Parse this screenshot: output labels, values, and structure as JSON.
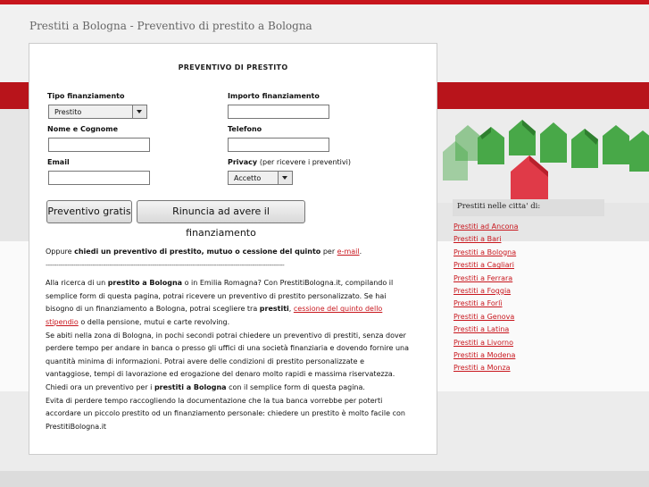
{
  "header": {
    "title": "Prestiti a Bologna - Preventivo di prestito a Bologna"
  },
  "form": {
    "title": "PREVENTIVO DI PRESTITO",
    "tipo_label": "Tipo finanziamento",
    "tipo_value": "Prestito",
    "importo_label": "Importo finanziamento",
    "importo_value": "",
    "nome_label": "Nome e Cognome",
    "nome_value": "",
    "telefono_label": "Telefono",
    "telefono_value": "",
    "email_label": "Email",
    "email_value": "",
    "privacy_label": "Privacy",
    "privacy_note": "(per ricevere i preventivi)",
    "privacy_value": "Accetto",
    "submit_label": "Preventivo gratis",
    "cancel_label": "Rinuncia ad avere il finanziamento"
  },
  "content": {
    "oppure_pre": "Oppure ",
    "oppure_bold": "chiedi un preventivo di prestito, mutuo o cessione del quinto",
    "oppure_mid": " per ",
    "oppure_link": "e-mail",
    "oppure_post": ".",
    "separator": "----------------------------------------------------------------------------------------------------------------",
    "p1_a": "Alla ricerca di un ",
    "p1_b": "prestito a Bologna",
    "p1_c": " o in Emilia Romagna? Con PrestitiBologna.it, compilando il semplice form di questa pagina, potrai ricevere un preventivo di prestito personalizzato. Se hai bisogno di un finanziamento a Bologna, potrai scegliere tra ",
    "p1_d": "prestiti",
    "p1_e": ", ",
    "p1_link": "cessione del quinto dello stipendio",
    "p1_f": " o della pensione, mutui e carte revolving.",
    "p2_a": "Se abiti nella zona di Bologna, in pochi secondi potrai chiedere un preventivo di prestiti, senza dover perdere tempo per andare in banca o presso gli uffici di una società finanziaria e dovendo fornire una quantità minima di informazioni. Potrai avere delle condizioni di prestito personalizzate e vantaggiose, tempi di lavorazione ed erogazione del denaro molto rapidi e massima riservatezza. Chiedi ora un preventivo per i ",
    "p2_b": "prestiti a Bologna",
    "p2_c": " con il semplice form di questa pagina.",
    "p3": "Evita di perdere tempo raccogliendo la documentazione che la tua banca vorrebbe per poterti accordare un piccolo prestito od un finanziamento personale: chiedere un prestito è molto facile con PrestitiBologna.it"
  },
  "sidebar": {
    "heading": "Prestiti nelle citta' di:",
    "links": [
      "Prestiti ad Ancona",
      "Prestiti a Bari",
      "Prestiti a Bologna",
      "Prestiti a Cagliari",
      "Prestiti a Ferrara",
      "Prestiti a Foggia",
      "Prestiti a Forlì",
      "Prestiti a Genova",
      "Prestiti a Latina",
      "Prestiti a Livorno",
      "Prestiti a Modena",
      "Prestiti a Monza"
    ]
  },
  "colors": {
    "brand_red": "#c8161d",
    "house_green": "#4bab4b",
    "house_red": "#e03040"
  },
  "icons": {
    "houses": "houses-illustration"
  }
}
